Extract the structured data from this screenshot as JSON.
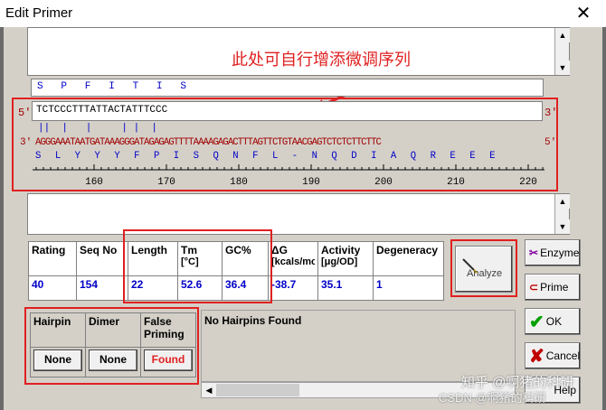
{
  "window": {
    "title": "Edit Primer",
    "close_glyph": "✕"
  },
  "annotation": {
    "text": "此处可自行增添微调序列"
  },
  "sequence": {
    "primer_aa": "S   P   F   I   T   I   S",
    "primer_seq": "TCTCCCTTTATTACTATTTCCC",
    "label5_left": "5'",
    "label3_right": "3'",
    "label3_left": "3'",
    "label5_right": "5'",
    "ticks": "||  |   |     | |  |",
    "template_seq": "AGGGAAATAATGATAAAGGGATAGAGAGTTTTAAAAGAGACTTTAGTTCTGTAACGAGTCTCTCTTCTTC",
    "template_aa": "S   L   Y   Y   Y   F   P   I   S   Q   N   F   L   -   N   Q   D   I   A   Q   R   E   E   E",
    "ruler_labels": [
      "160",
      "170",
      "180",
      "190",
      "200",
      "210",
      "220"
    ]
  },
  "stats": {
    "headers": {
      "rating": "Rating",
      "seqno": "Seq No",
      "length": "Length",
      "tm": "Tm",
      "tm_unit": "[°C]",
      "gc": "GC%",
      "dg": "ΔG",
      "dg_unit": "[kcals/mo",
      "activity": "Activity",
      "activity_unit": "[μg/OD]",
      "degeneracy": "Degeneracy"
    },
    "values": {
      "rating": "40",
      "seqno": "154",
      "length": "22",
      "tm": "52.6",
      "gc": "36.4",
      "dg": "-38.7",
      "activity": "35.1",
      "degeneracy": "1"
    }
  },
  "analyze": {
    "label": "Analyze"
  },
  "checks": {
    "headers": {
      "hairpin": "Hairpin",
      "dimer": "Dimer",
      "false_priming": "False Priming"
    },
    "buttons": {
      "hairpin": "None",
      "dimer": "None",
      "false_priming": "Found"
    }
  },
  "message": {
    "text": "No Hairpins Found"
  },
  "side_buttons": {
    "enzyme": "Enzyme",
    "prime": "Prime",
    "ok": "OK",
    "cancel": "Cancel",
    "help": "Help"
  },
  "watermark": {
    "text": "知乎 @啊猪的科研",
    "sub": "CSDN @啊猪的科研"
  }
}
